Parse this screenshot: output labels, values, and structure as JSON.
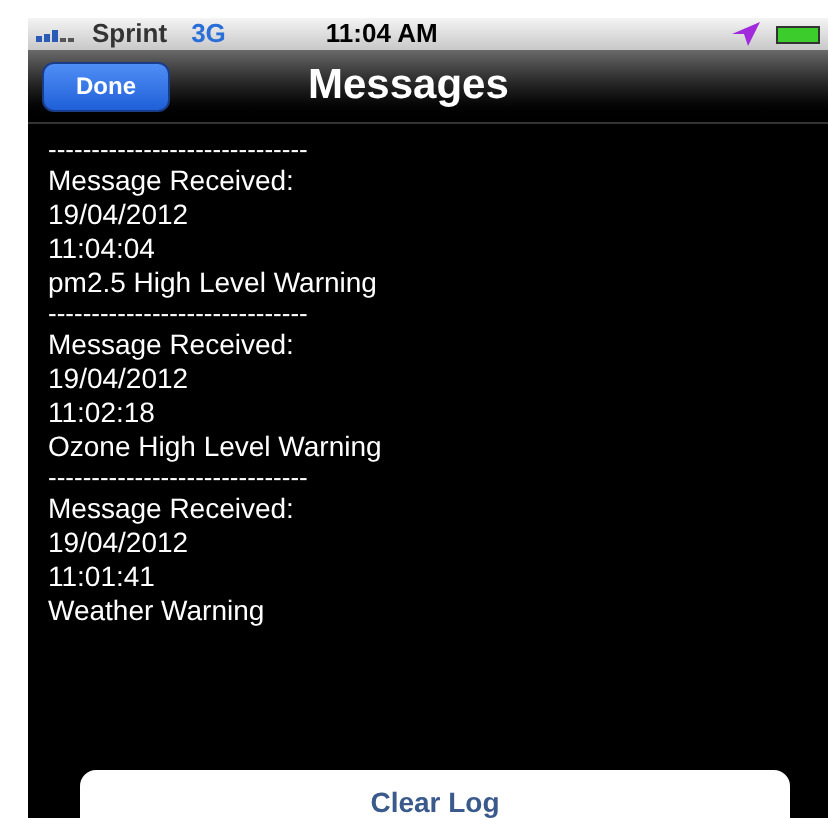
{
  "status_bar": {
    "carrier": "Sprint",
    "network": "3G",
    "time": "11:04 AM"
  },
  "nav_bar": {
    "done_button": "Done",
    "title": "Messages"
  },
  "log": [
    {
      "separator": "------------------------------",
      "heading": "Message Received:",
      "date": "19/04/2012",
      "time": "11:04:04",
      "message": "pm2.5 High Level Warning"
    },
    {
      "separator": "------------------------------",
      "heading": "Message Received:",
      "date": "19/04/2012",
      "time": "11:02:18",
      "message": "Ozone High Level Warning"
    },
    {
      "separator": "------------------------------",
      "heading": "Message Received:",
      "date": "19/04/2012",
      "time": "11:01:41",
      "message": "Weather Warning"
    }
  ],
  "clear_button": "Clear Log"
}
